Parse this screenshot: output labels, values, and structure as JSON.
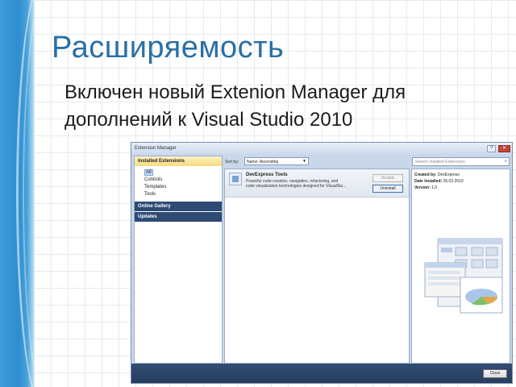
{
  "slide": {
    "title": "Расширяемость",
    "text_line1": "Включен новый Extenion Manager для",
    "text_line2": "дополнений к Visual Studio 2010"
  },
  "window": {
    "title": "Extension Manager",
    "help_label": "?",
    "close_glyph": "✕",
    "sidebar": {
      "installed_header": "Installed Extensions",
      "items": [
        "All",
        "Controls",
        "Templates",
        "Tools"
      ],
      "selected": "All",
      "online_gallery": "Online Gallery",
      "updates": "Updates"
    },
    "sort": {
      "label": "Sort by:",
      "value": "Name: Ascending"
    },
    "search": {
      "placeholder": "Search Installed Extensions"
    },
    "extension": {
      "name": "DevExpress Tools",
      "desc_line1": "Powerful code-creation, navigation, refactoring, and",
      "desc_line2": "code visualization technologies designed for VisualStu...",
      "disable_label": "Disable",
      "uninstall_label": "Uninstall"
    },
    "details": {
      "created_by_label": "Created by:",
      "created_by": "DevExpress",
      "date_installed_label": "Date Installed:",
      "date_installed": "26.03.2010",
      "version_label": "Version:",
      "version": "1.0"
    },
    "close_button": "Close"
  },
  "colors": {
    "accent_blue": "#2a6fa4",
    "sidebar_section": "#2e4b73",
    "header_gold": "#f7dc7c"
  }
}
